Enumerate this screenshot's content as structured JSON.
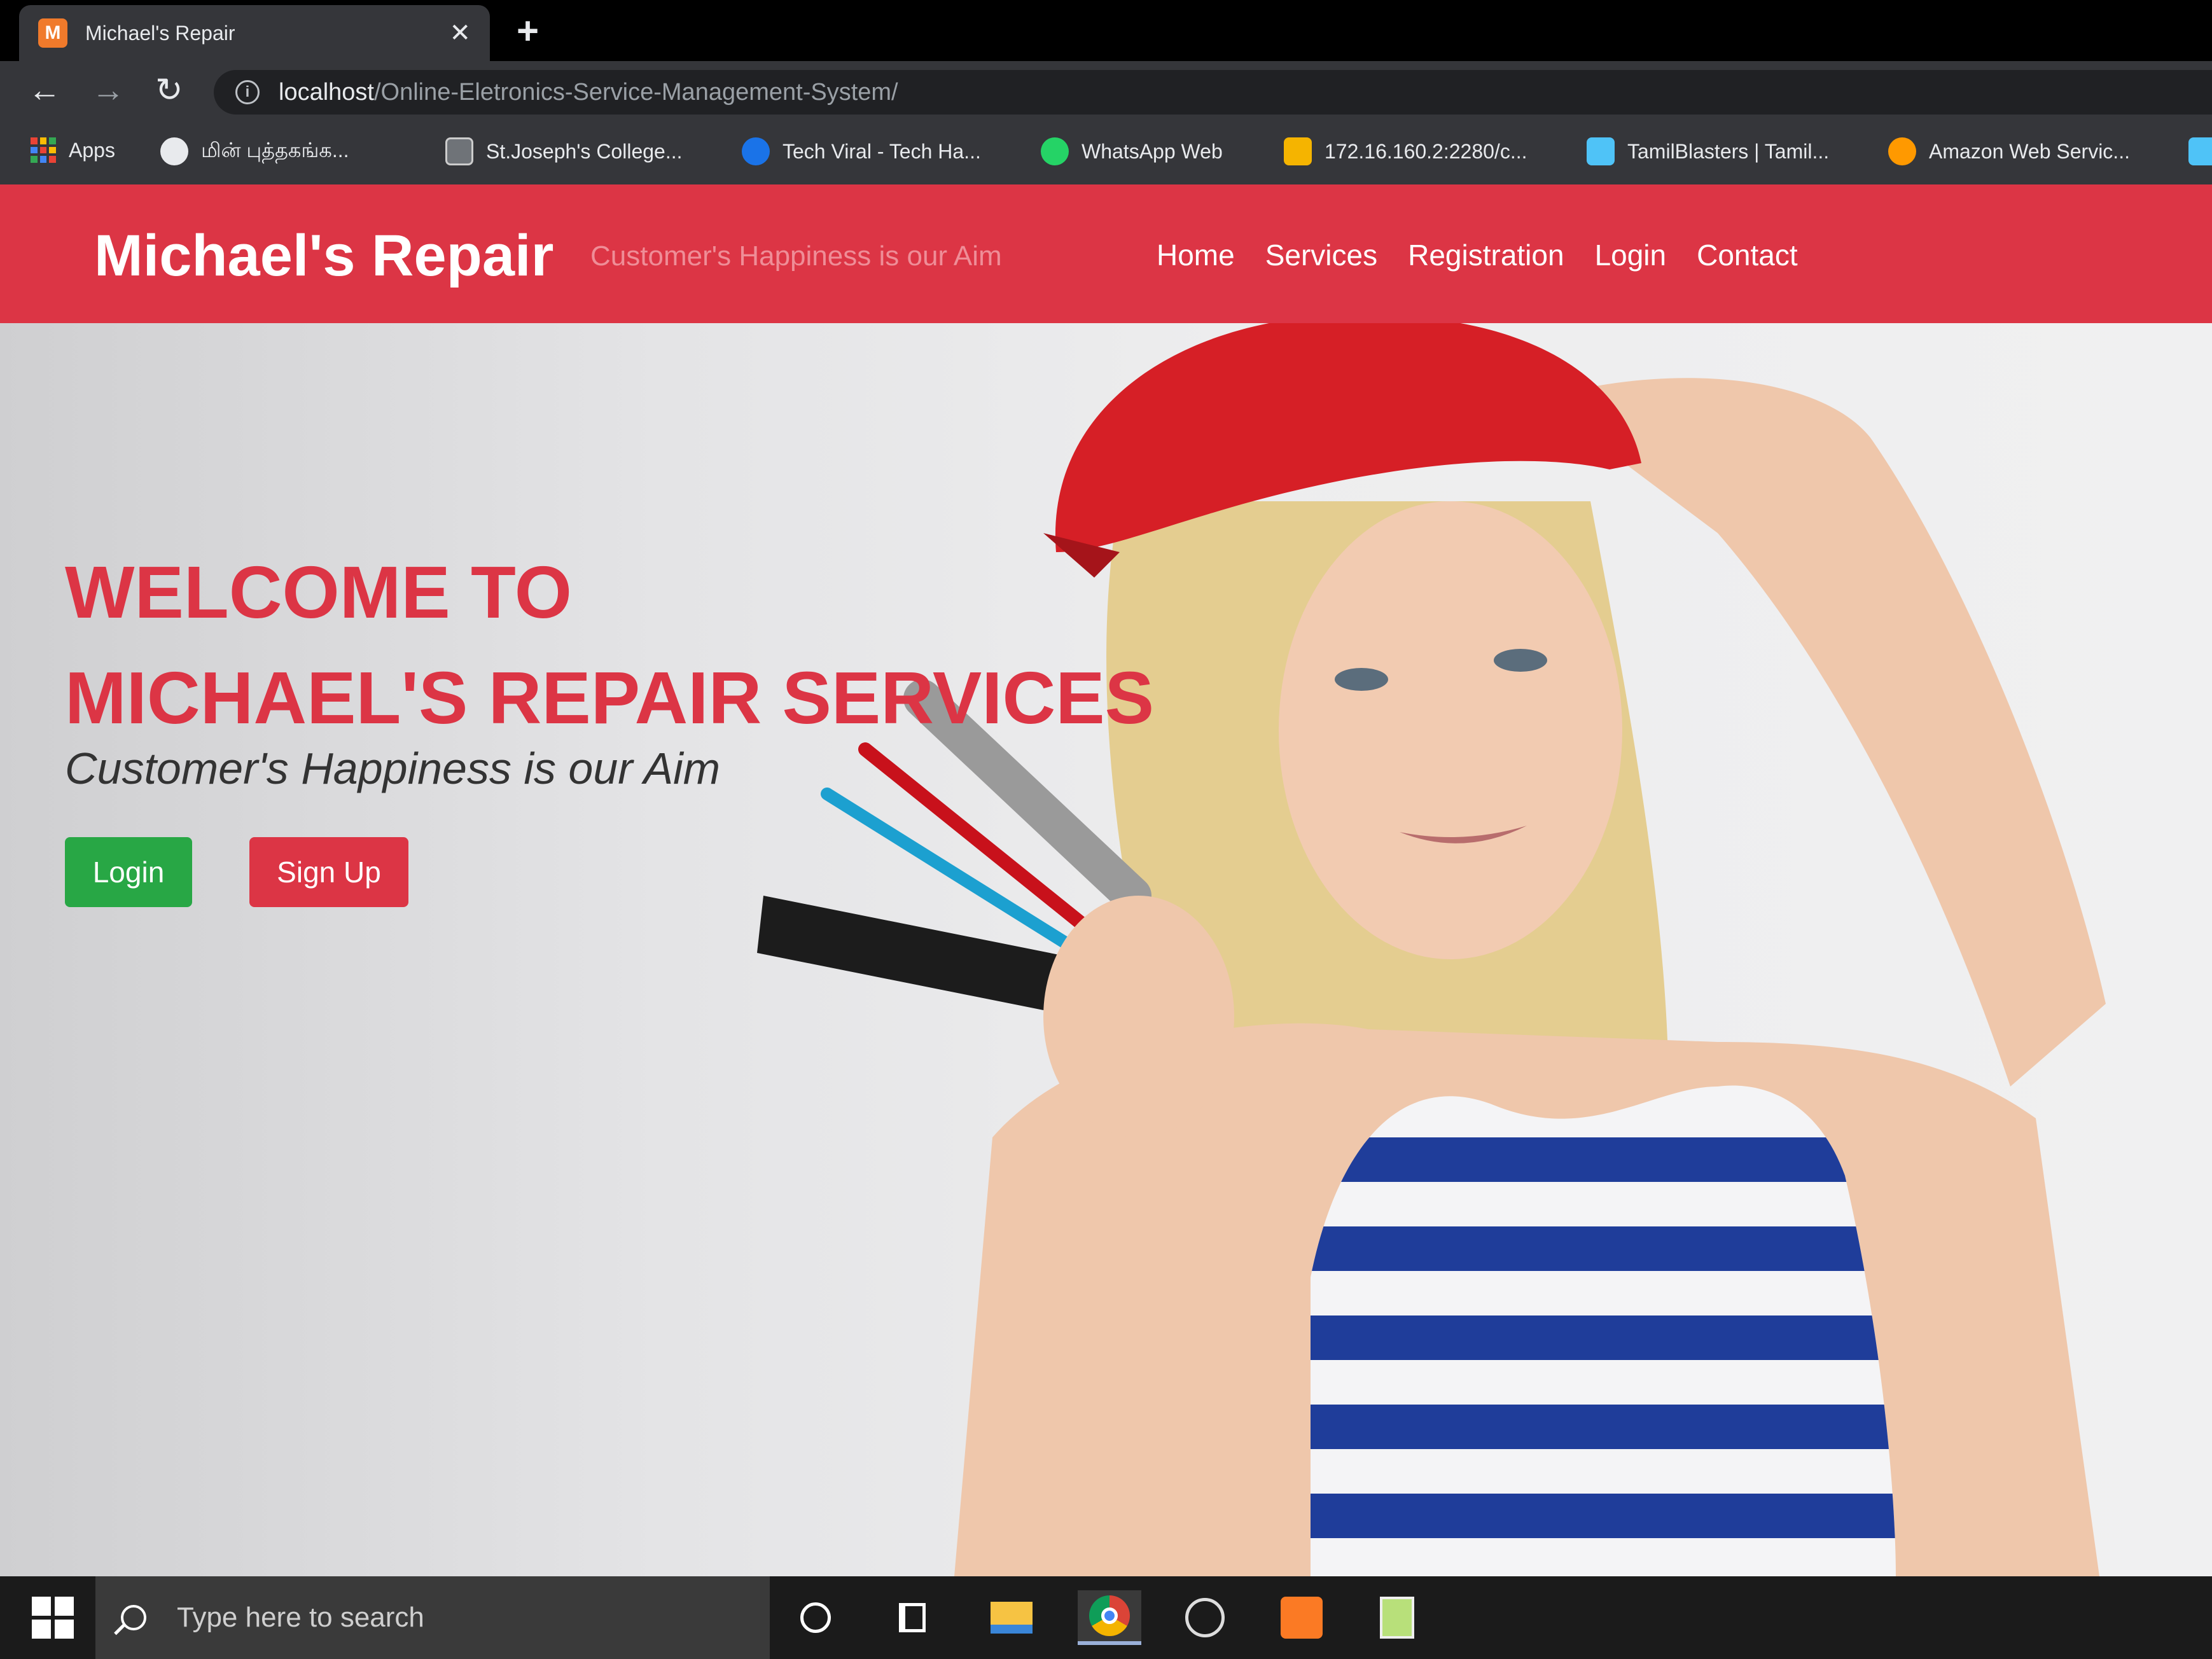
{
  "browser": {
    "tab_title": "Michael's Repair",
    "tab_favicon_letter": "M",
    "close_glyph": "✕",
    "new_tab_glyph": "+",
    "back_glyph": "←",
    "forward_glyph": "→",
    "reload_glyph": "↻",
    "info_glyph": "i",
    "url_host": "localhost",
    "url_path": "/Online-Eletronics-Service-Management-System/"
  },
  "bookmarks": [
    {
      "label": "Apps",
      "icon": "apps-icon",
      "color": "#4285f4"
    },
    {
      "label": "மின் புத்தகங்க...",
      "icon": "globe-icon",
      "color": "#e8eaed"
    },
    {
      "label": "St.Joseph's College...",
      "icon": "college-icon",
      "color": "#9aa0a6"
    },
    {
      "label": "Tech Viral - Tech Ha...",
      "icon": "techviral-icon",
      "color": "#1a73e8"
    },
    {
      "label": "WhatsApp Web",
      "icon": "whatsapp-icon",
      "color": "#25d366"
    },
    {
      "label": "172.16.160.2:2280/c...",
      "icon": "gift-icon",
      "color": "#f5b400"
    },
    {
      "label": "TamilBlasters | Tamil...",
      "icon": "tamilblasters-icon",
      "color": "#4fc3f7"
    },
    {
      "label": "Amazon Web Servic...",
      "icon": "aws-icon",
      "color": "#ff9900"
    }
  ],
  "site": {
    "brand": "Michael's Repair",
    "tagline": "Customer's Happiness is our Aim",
    "menu": [
      "Home",
      "Services",
      "Registration",
      "Login",
      "Contact"
    ],
    "colors": {
      "primary": "#dc3545",
      "success": "#28a745"
    }
  },
  "hero": {
    "title_line1": "WELCOME TO",
    "title_line2": "MICHAEL'S REPAIR SERVICES",
    "subtitle": "Customer's Happiness is our Aim",
    "login_button": "Login",
    "signup_button": "Sign Up"
  },
  "taskbar": {
    "search_placeholder": "Type here to search",
    "apps": [
      "cortana-icon",
      "task-view-icon",
      "file-explorer-icon",
      "chrome-icon",
      "clock-app-icon",
      "xampp-icon",
      "notepad-icon"
    ]
  }
}
